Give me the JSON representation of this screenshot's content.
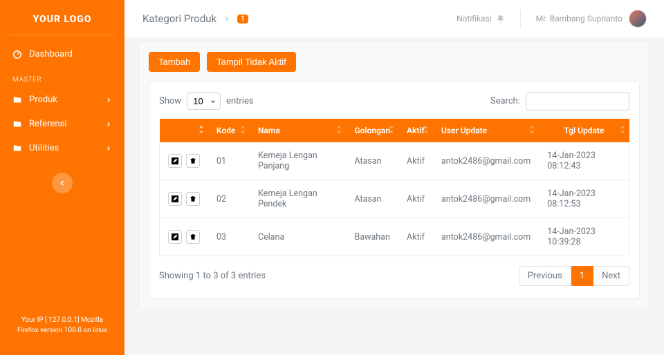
{
  "brand": "YOUR LOGO",
  "sidebar": {
    "dashboard": "Dashboard",
    "section_label": "MASTER",
    "items": [
      {
        "label": "Produk"
      },
      {
        "label": "Referensi"
      },
      {
        "label": "Utilities"
      }
    ],
    "footer_line1": "Your IP [ 127.0.0.1] Mozilla",
    "footer_line2": "Firefox version 108.0 on linux"
  },
  "topbar": {
    "page_title": "Kategori Produk",
    "badge": "1",
    "notif_label": "Notifikasi",
    "user_name": "Mr. Bambang Suprianto"
  },
  "buttons": {
    "tambah": "Tambah",
    "tampil_tidak_aktif": "Tampil Tidak Aktif"
  },
  "datatable": {
    "show_label": "Show",
    "entries_label": "entries",
    "length_value": "10",
    "search_label": "Search:",
    "columns": {
      "actions": "",
      "kode": "Kode",
      "nama": "Nama",
      "golongan": "Golongan",
      "aktif": "Aktif",
      "user_update": "User Update",
      "tgl_update": "Tgl Update"
    },
    "rows": [
      {
        "kode": "01",
        "nama": "Kemeja Lengan Panjang",
        "golongan": "Atasan",
        "aktif": "Aktif",
        "user_update": "antok2486@gmail.com",
        "tgl_update": "14-Jan-2023 08:12:43"
      },
      {
        "kode": "02",
        "nama": "Kemeja Lengan Pendek",
        "golongan": "Atasan",
        "aktif": "Aktif",
        "user_update": "antok2486@gmail.com",
        "tgl_update": "14-Jan-2023 08:12:53"
      },
      {
        "kode": "03",
        "nama": "Celana",
        "golongan": "Bawahan",
        "aktif": "Aktif",
        "user_update": "antok2486@gmail.com",
        "tgl_update": "14-Jan-2023 10:39:28"
      }
    ],
    "info": "Showing 1 to 3 of 3 entries",
    "pagination": {
      "previous": "Previous",
      "next": "Next",
      "current": "1"
    }
  }
}
